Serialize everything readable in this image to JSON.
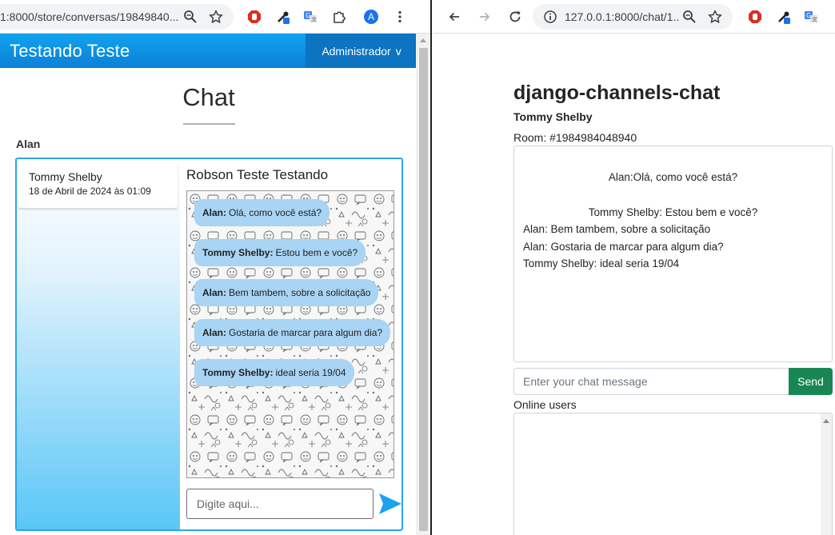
{
  "left_window": {
    "address": "1:8000/store/conversas/19849840...",
    "profile_initial": "A",
    "app": {
      "brand": "Testando Teste",
      "admin_menu": "Administrador",
      "admin_caret": "v",
      "page_title": "Chat",
      "user_label": "Alan",
      "conversation": {
        "name": "Tommy Shelby",
        "date": "18 de Abril de 2024 às 01:09"
      },
      "room_title": "Robson Teste Testando",
      "messages": [
        {
          "sender": "Alan:",
          "text": "Olá, como você está?"
        },
        {
          "sender": "Tommy Shelby:",
          "text": "Estou bem e você?"
        },
        {
          "sender": "Alan:",
          "text": "Bem tambem, sobre a solicitação"
        },
        {
          "sender": "Alan:",
          "text": "Gostaria de marcar para algum dia?"
        },
        {
          "sender": "Tommy Shelby:",
          "text": "ideal seria 19/04"
        }
      ],
      "input_placeholder": "Digite aqui..."
    }
  },
  "right_window": {
    "address": "127.0.0.1:8000/chat/1...",
    "app": {
      "title": "django-channels-chat",
      "user": "Tommy Shelby",
      "room": "Room: #1984984048940",
      "log": [
        "Alan:Olá, como você está?",
        "Tommy Shelby: Estou bem e você?",
        "Alan: Bem tambem, sobre a solicitação",
        "Alan: Gostaria de marcar para algum dia?",
        "Tommy Shelby: ideal seria 19/04"
      ],
      "input_placeholder": "Enter your chat message",
      "send_label": "Send",
      "online_label": "Online users"
    }
  },
  "icons": {
    "toolbar": [
      "zoom-icon",
      "star-icon",
      "extension-red-icon",
      "eyedropper-icon",
      "translate-icon",
      "puzzle-icon",
      "profile-icon",
      "more-icon",
      "back-icon",
      "forward-icon",
      "reload-icon",
      "info-icon"
    ],
    "send": "send-arrow-icon"
  },
  "colors": {
    "navbar": "#0a8ee0",
    "bubble": "#a9d4f3",
    "send_button": "#198754",
    "chat_border": "#2ea6e6"
  }
}
